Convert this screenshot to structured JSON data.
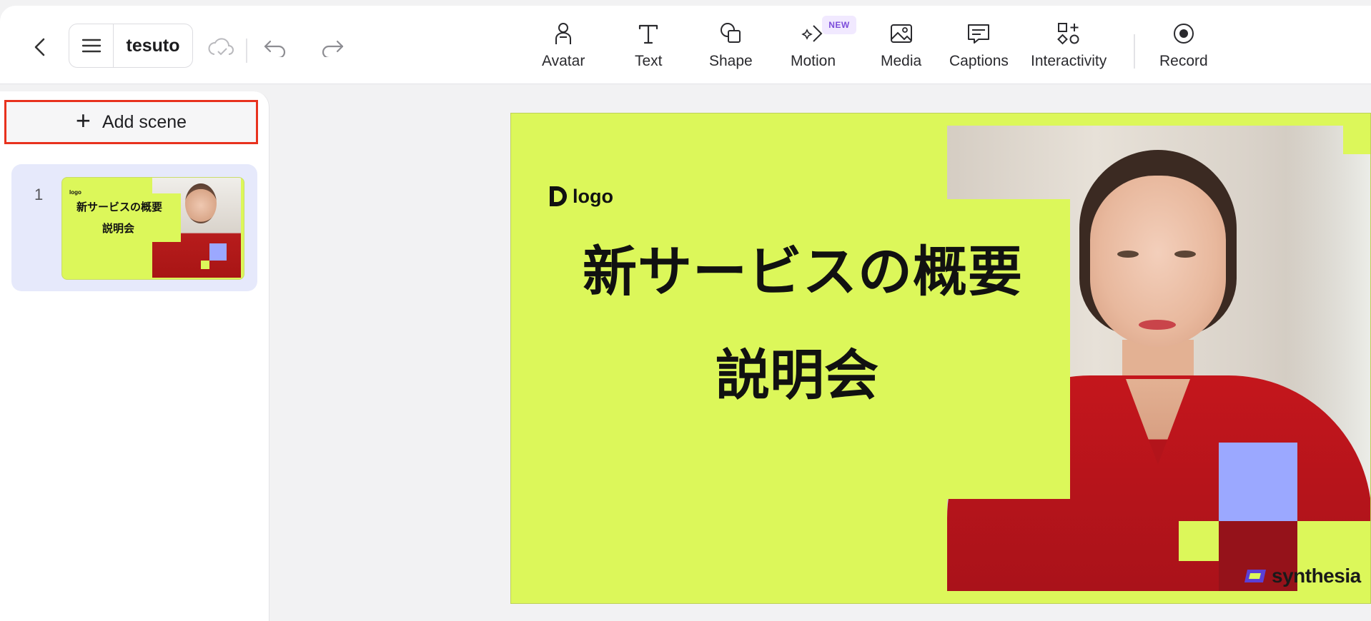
{
  "header": {
    "project_title": "tesuto",
    "new_badge": "NEW"
  },
  "toolbar": {
    "tools": [
      {
        "label": "Avatar",
        "icon": "avatar-icon"
      },
      {
        "label": "Text",
        "icon": "text-icon"
      },
      {
        "label": "Shape",
        "icon": "shape-icon"
      },
      {
        "label": "Motion",
        "icon": "motion-icon"
      },
      {
        "label": "Media",
        "icon": "media-icon"
      },
      {
        "label": "Captions",
        "icon": "captions-icon"
      },
      {
        "label": "Interactivity",
        "icon": "interactivity-icon"
      },
      {
        "label": "Record",
        "icon": "record-icon"
      }
    ]
  },
  "sidebar": {
    "add_scene_label": "Add scene",
    "scenes": [
      {
        "number": "1",
        "thumb_logo": "logo",
        "thumb_title_line1": "新サービスの概要",
        "thumb_title_line2": "説明会"
      }
    ]
  },
  "canvas": {
    "logo_text": "logo",
    "title_line1": "新サービスの概要",
    "title_line2": "説明会",
    "watermark": "synthesia",
    "colors": {
      "background": "#dcf75a",
      "accent_blue": "#9ba8ff",
      "shirt_red": "#c4161c"
    }
  }
}
